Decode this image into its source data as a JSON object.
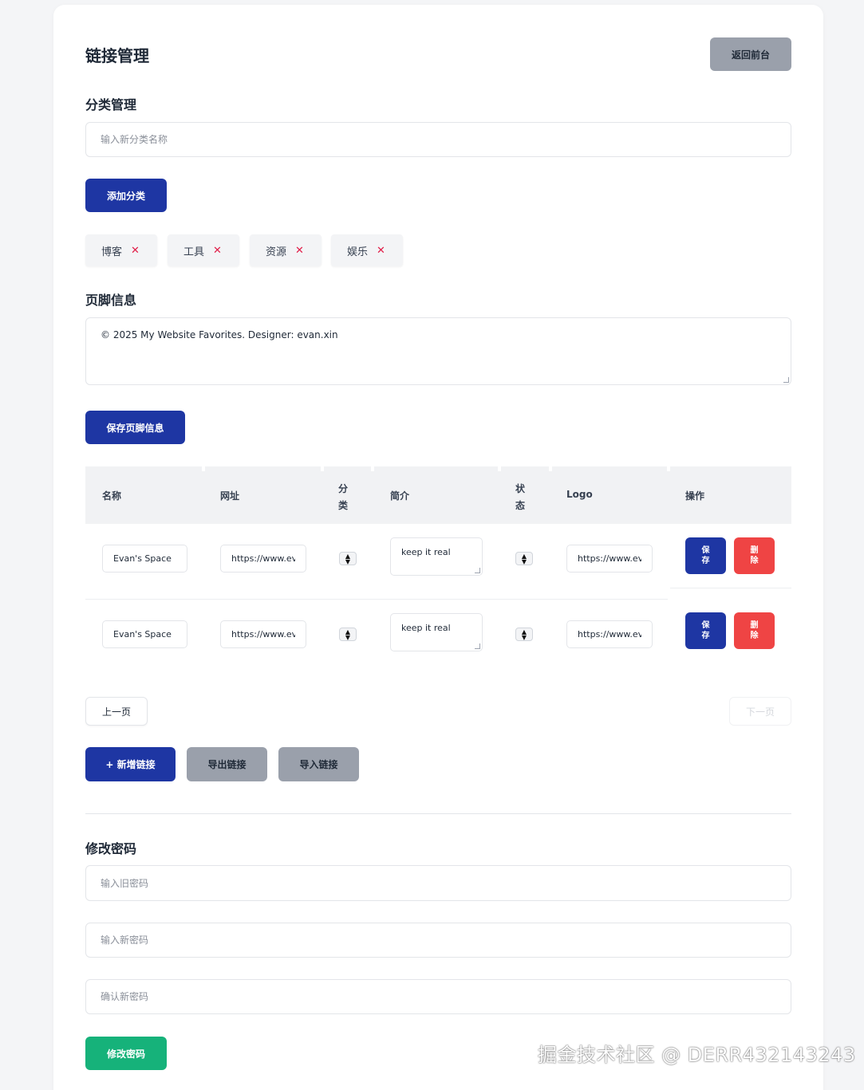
{
  "header": {
    "title": "链接管理",
    "back_button": "返回前台"
  },
  "category": {
    "section_title": "分类管理",
    "input_placeholder": "输入新分类名称",
    "add_button": "添加分类",
    "tags": [
      {
        "label": "博客",
        "remove": "✕"
      },
      {
        "label": "工具",
        "remove": "✕"
      },
      {
        "label": "资源",
        "remove": "✕"
      },
      {
        "label": "娱乐",
        "remove": "✕"
      }
    ]
  },
  "footer_info": {
    "section_title": "页脚信息",
    "value": "© 2025 My Website Favorites. Designer: evan.xin",
    "save_button": "保存页脚信息"
  },
  "table": {
    "headers": {
      "name": "名称",
      "url": "网址",
      "category_line1": "分",
      "category_line2": "类",
      "desc": "简介",
      "status_line1": "状",
      "status_line2": "态",
      "logo": "Logo",
      "actions": "操作"
    },
    "rows": [
      {
        "name": "Evan's Space",
        "url": "https://www.evan.xin",
        "desc": "keep it real",
        "logo": "https://www.evan.xin/logo.png",
        "save_line1": "保",
        "save_line2": "存",
        "delete_line1": "删",
        "delete_line2": "除"
      },
      {
        "name": "Evan's Space",
        "url": "https://www.evan.xin",
        "desc": "keep it real",
        "logo": "https://www.evan.xin/logo.png",
        "save_line1": "保",
        "save_line2": "存",
        "delete_line1": "删",
        "delete_line2": "除"
      }
    ]
  },
  "pagination": {
    "prev": "上一页",
    "next": "下一页"
  },
  "link_actions": {
    "add": "+ 新增链接",
    "export": "导出链接",
    "import": "导入链接"
  },
  "password": {
    "section_title": "修改密码",
    "old_placeholder": "输入旧密码",
    "new_placeholder": "输入新密码",
    "confirm_placeholder": "确认新密码",
    "submit": "修改密码"
  },
  "watermark": "掘金技术社区 @ DERR432143243",
  "colors": {
    "primary": "#1e36a3",
    "secondary": "#9aa0ab",
    "danger": "#ef4444",
    "success": "#16b27a",
    "background": "#f4f5f7"
  }
}
